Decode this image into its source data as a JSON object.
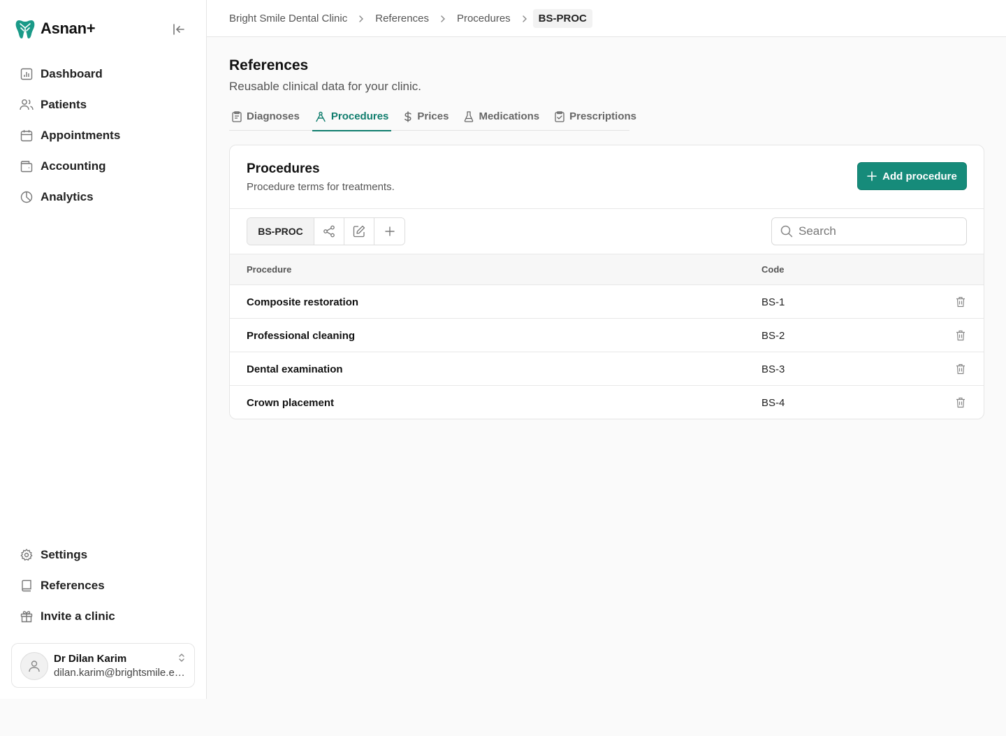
{
  "app": {
    "name": "Asnan+"
  },
  "sidebar": {
    "nav_top": [
      {
        "label": "Dashboard",
        "icon": "dashboard-icon"
      },
      {
        "label": "Patients",
        "icon": "users-icon"
      },
      {
        "label": "Appointments",
        "icon": "calendar-icon"
      },
      {
        "label": "Accounting",
        "icon": "wallet-icon"
      },
      {
        "label": "Analytics",
        "icon": "pie-chart-icon"
      }
    ],
    "nav_bottom": [
      {
        "label": "Settings",
        "icon": "gear-icon"
      },
      {
        "label": "References",
        "icon": "book-icon"
      },
      {
        "label": "Invite a clinic",
        "icon": "gift-icon"
      }
    ],
    "user": {
      "name": "Dr Dilan Karim",
      "email": "dilan.karim@brightsmile.example"
    }
  },
  "breadcrumb": [
    "Bright Smile Dental Clinic",
    "References",
    "Procedures",
    "BS-PROC"
  ],
  "page": {
    "title": "References",
    "subtitle": "Reusable clinical data for your clinic."
  },
  "tabs": [
    {
      "label": "Diagnoses",
      "icon": "clipboard-list-icon",
      "active": false
    },
    {
      "label": "Procedures",
      "icon": "procedure-icon",
      "active": true
    },
    {
      "label": "Prices",
      "icon": "dollar-icon",
      "active": false
    },
    {
      "label": "Medications",
      "icon": "flask-icon",
      "active": false
    },
    {
      "label": "Prescriptions",
      "icon": "clipboard-check-icon",
      "active": false
    }
  ],
  "card": {
    "title": "Procedures",
    "subtitle": "Procedure terms for treatments.",
    "add_label": "Add procedure",
    "reference_code": "BS-PROC",
    "search_placeholder": "Search",
    "columns": {
      "procedure": "Procedure",
      "code": "Code"
    },
    "rows": [
      {
        "procedure": "Composite restoration",
        "code": "BS-1"
      },
      {
        "procedure": "Professional cleaning",
        "code": "BS-2"
      },
      {
        "procedure": "Dental examination",
        "code": "BS-3"
      },
      {
        "procedure": "Crown placement",
        "code": "BS-4"
      }
    ]
  },
  "colors": {
    "accent": "#0f7d6d",
    "button": "#168b7a",
    "logo": "#1a9a88"
  }
}
